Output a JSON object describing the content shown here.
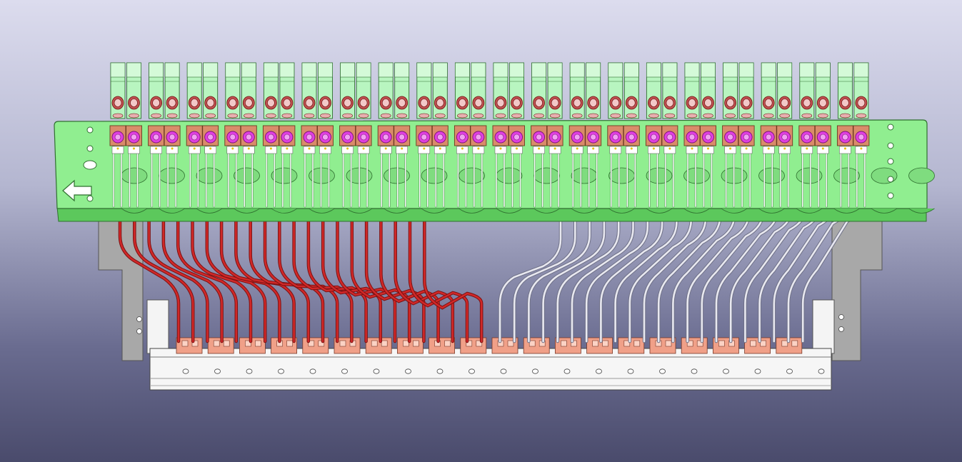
{
  "viewport": {
    "background_top": "#dcdcee",
    "background_bottom": "#4a4b6c"
  },
  "assembly": {
    "module_pairs": 20,
    "terminal_slots_per_pair": 2,
    "left_wire_count": 22,
    "right_wire_count": 22,
    "colors": {
      "plate": "#90ee90",
      "plate_shadow": "#5cc85c",
      "slot_body": "#b8f5c0",
      "contact_block": "#d98c6a",
      "contact_ring": "#e040e0",
      "coil": "#b03030",
      "wire_left": "#d02828",
      "wire_right": "#e8e8f0",
      "frame": "#a9a9a9",
      "rail": "#f4f4f4",
      "terminal": "#f0a088"
    },
    "icons": [
      "arrow-left-icon"
    ]
  }
}
